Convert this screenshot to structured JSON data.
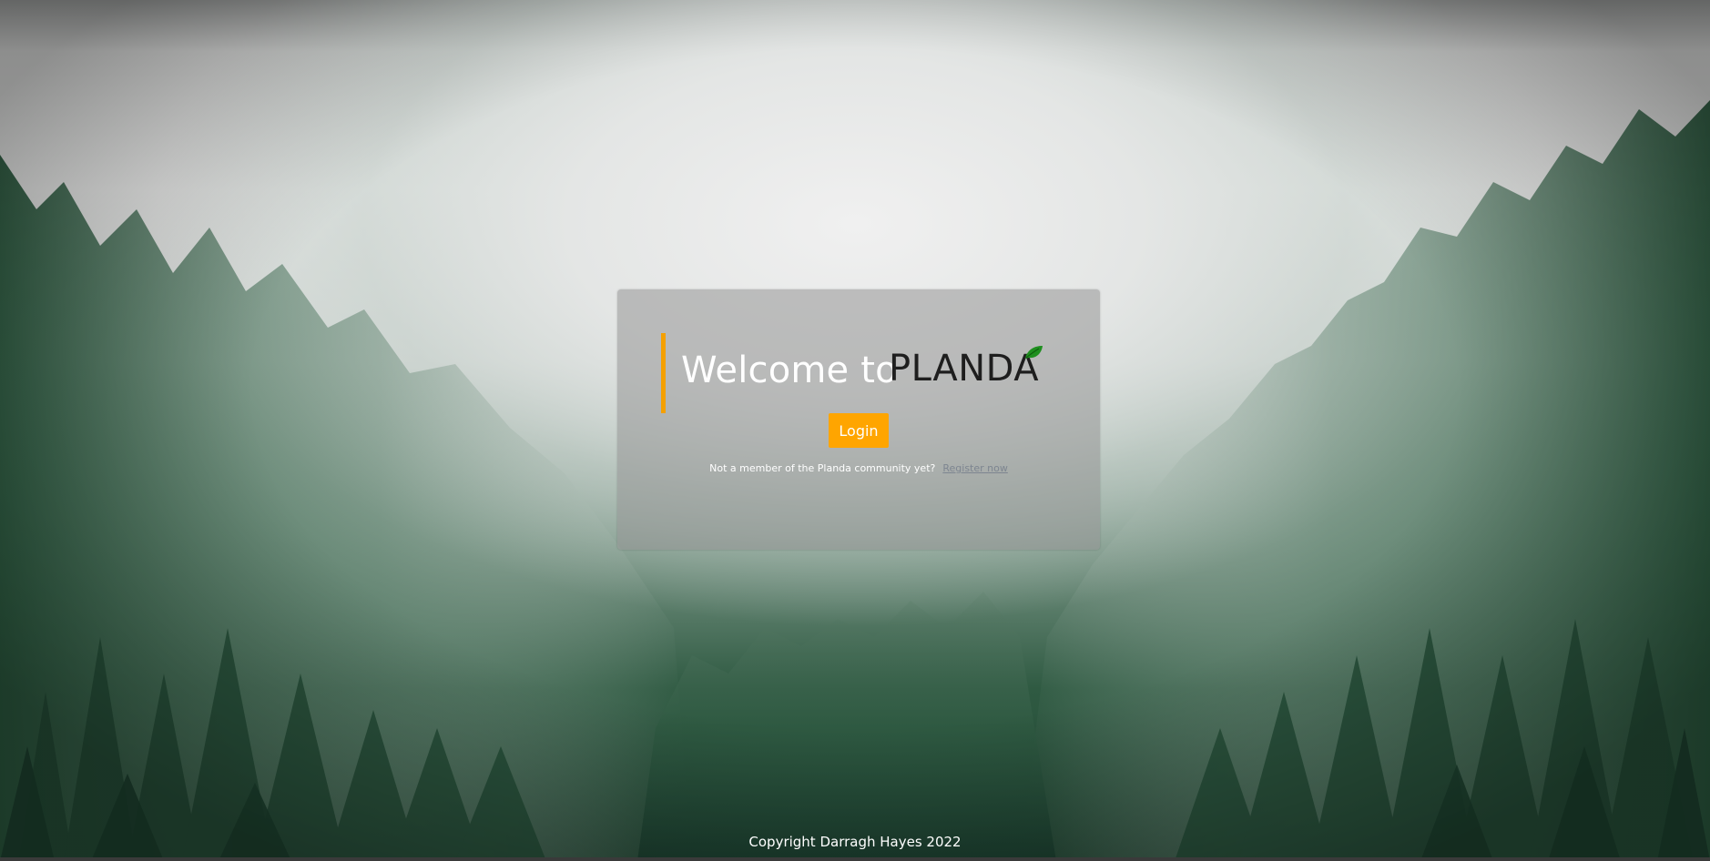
{
  "login_card": {
    "welcome_text": "Welcome to",
    "brand_name": "PLANDA",
    "login_button_label": "Login",
    "register_prompt": "Not a member of the Planda community yet?",
    "register_link_label": "Register now"
  },
  "footer": {
    "copyright": "Copyright Darragh Hayes 2022"
  },
  "colors": {
    "accent": "#ffa500",
    "leaf": "#1f8f1f",
    "card_background": "rgba(150,150,150,0.55)"
  },
  "icons": {
    "brand_leaf": "leaf-icon"
  }
}
